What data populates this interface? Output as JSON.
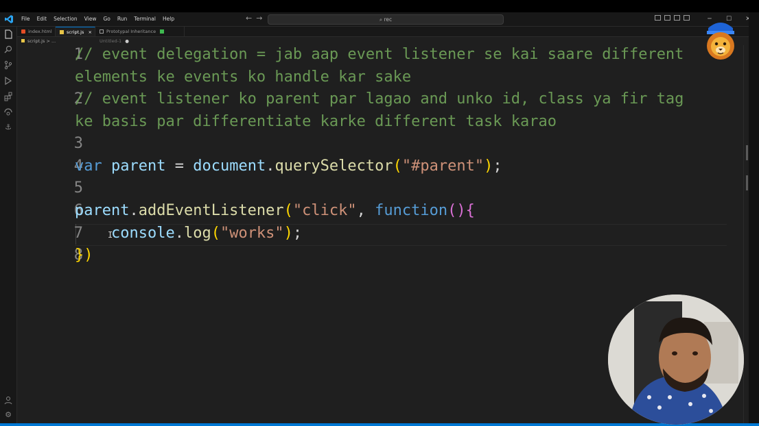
{
  "menu": [
    "File",
    "Edit",
    "Selection",
    "View",
    "Go",
    "Run",
    "Terminal",
    "Help"
  ],
  "search": {
    "value": "rec"
  },
  "tabs": [
    {
      "label": "index.html",
      "active": false
    },
    {
      "label": "script.js",
      "active": true,
      "close": "×"
    },
    {
      "label": "Prototypal Inheritance",
      "active": false
    },
    {
      "label": "Untitled-1",
      "active": false,
      "dirty": "●"
    }
  ],
  "breadcrumb": "script.js > ...",
  "colors": {
    "accent": "#0078d4",
    "comment": "#6a9955",
    "keyword": "#569cd6",
    "variable": "#9cdcfe",
    "function": "#dcdcaa",
    "string": "#ce9178"
  },
  "icons": [
    "vscode-logo-icon",
    "explorer-icon",
    "search-icon",
    "source-control-icon",
    "run-debug-icon",
    "extensions-icon",
    "remote-icon",
    "anchor-icon",
    "account-icon",
    "settings-gear-icon"
  ],
  "code": {
    "line_numbers": [
      "1",
      "",
      "2",
      "",
      "3",
      "4",
      "5",
      "6",
      "7",
      "8"
    ],
    "lines": [
      "// event delegation = jab aap event listener se kai saare different",
      "elements ke events ko handle kar sake",
      "// event listener ko parent par lagao and unko id, class ya fir tag",
      "ke basis par differentiate karke different task karao",
      "",
      "var parent = document.querySelector(\"#parent\");",
      "",
      "parent.addEventListener(\"click\", function(){",
      "    console.log(\"works\");",
      "})"
    ]
  }
}
